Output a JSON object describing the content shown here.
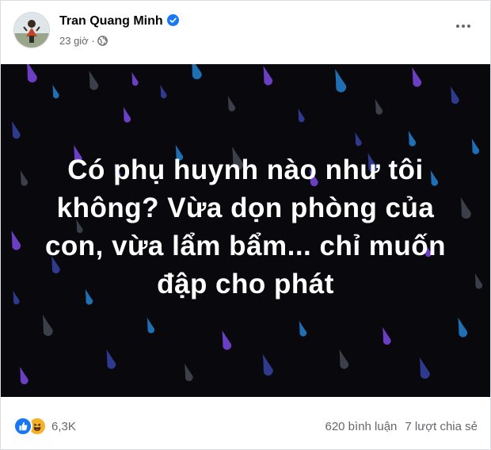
{
  "post": {
    "author": "Tran Quang Minh",
    "time": "23 giờ",
    "time_separator": "·",
    "verified_icon": "verified-badge-icon",
    "privacy_icon": "globe-icon",
    "more_icon": "more-options-icon"
  },
  "image": {
    "text": "Có phụ huynh nào như tôi\nkhông? Vừa dọn phòng của\ncon, vừa lẩm bẩm... chỉ muốn\nđập cho phát",
    "background": "#09090d",
    "drop_colors": [
      "#6b3fc4",
      "#2f3a8f",
      "#1f6fb5",
      "#3a3f4a"
    ]
  },
  "footer": {
    "reaction_icons": [
      "like-icon",
      "haha-icon"
    ],
    "reaction_count": "6,3K",
    "comments": "620 bình luận",
    "shares": "7 lượt chia sẻ"
  },
  "colors": {
    "brand_blue": "#1877f2",
    "secondary_text": "#65676b",
    "haha_yellow": "#f7b125"
  }
}
